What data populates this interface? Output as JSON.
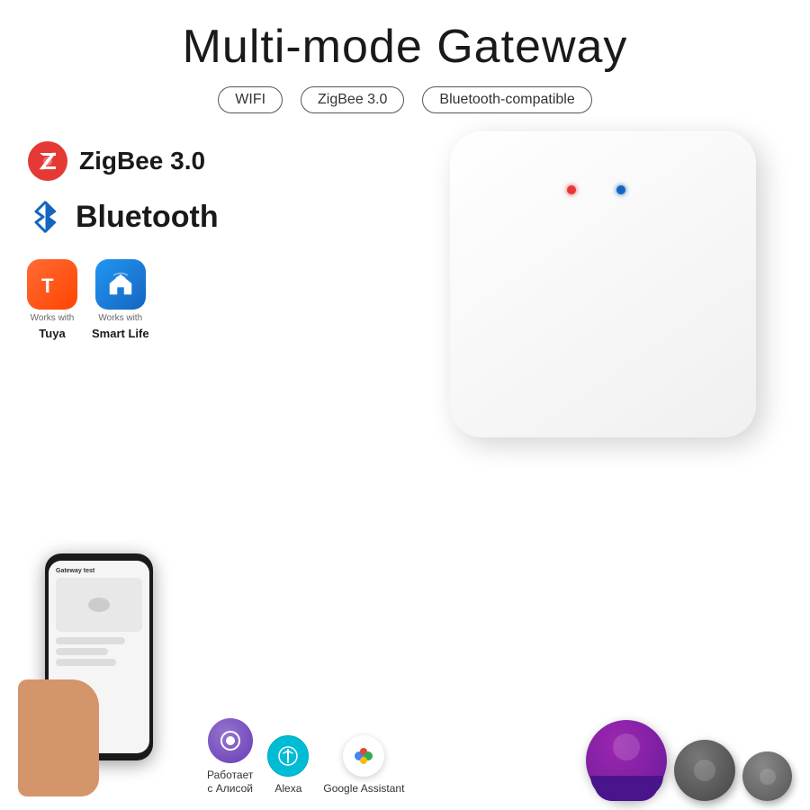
{
  "title": "Multi-mode Gateway",
  "tags": [
    {
      "label": "WIFI"
    },
    {
      "label": "ZigBee 3.0"
    },
    {
      "label": "Bluetooth-compatible"
    }
  ],
  "features": {
    "zigbee": {
      "label": "ZigBee 3.0"
    },
    "bluetooth": {
      "label": "Bluetooth"
    }
  },
  "apps": [
    {
      "name": "tuya",
      "works_with": "Works with",
      "label": "Tuya"
    },
    {
      "name": "smartlife",
      "works_with": "Works with",
      "label": "Smart Life"
    }
  ],
  "assistants": [
    {
      "name": "alice",
      "label": "Работает\nс Алисой"
    },
    {
      "name": "alexa",
      "label": "Alexa"
    },
    {
      "name": "google",
      "label": "Google Assistant"
    }
  ],
  "phone": {
    "screen_title": "Gateway test"
  }
}
